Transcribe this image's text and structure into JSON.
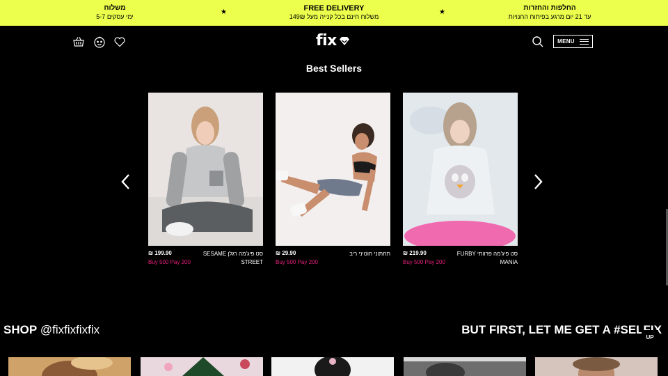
{
  "announcement": {
    "left": {
      "title": "משלוח",
      "subtitle": "5-7 ימי עסקים"
    },
    "middle": {
      "title": "FREE DELIVERY",
      "subtitle": "משלוח חינם בכל קנייה מעל 149₪"
    },
    "right": {
      "title": "החלפות והחזרות",
      "subtitle": "עד 21 יום מרגע בפיתוח החנויות"
    },
    "star": "★"
  },
  "header": {
    "logo_text": "fix",
    "menu_label": "MENU",
    "icons": [
      "basket-icon",
      "baby-icon",
      "heart-icon",
      "search-icon",
      "diamond-logo-icon"
    ]
  },
  "best_sellers": {
    "title": "Best Sellers",
    "products": [
      {
        "price": "₪ 199.90",
        "name": "SESAME סט פיג'מה רגלן STREET",
        "promo": "Buy 500 Pay 200"
      },
      {
        "price": "₪ 29.90",
        "name": "תחתוני חוטיני ריב",
        "promo": "Buy 500 Pay 200"
      },
      {
        "price": "₪ 219.90",
        "name": "FURBY סט פיג'מה פרוותי MANIA",
        "promo": "Buy 500 Pay 200"
      }
    ]
  },
  "instagram": {
    "shop_label": "SHOP",
    "handle": "@fixfixfixfix",
    "tagline": "BUT FIRST, LET ME GET A #SELFIX",
    "up_label": "UP"
  },
  "colors": {
    "announcement_bg": "#ecff4c",
    "promo": "#e5207a",
    "page_bg": "#000000"
  }
}
